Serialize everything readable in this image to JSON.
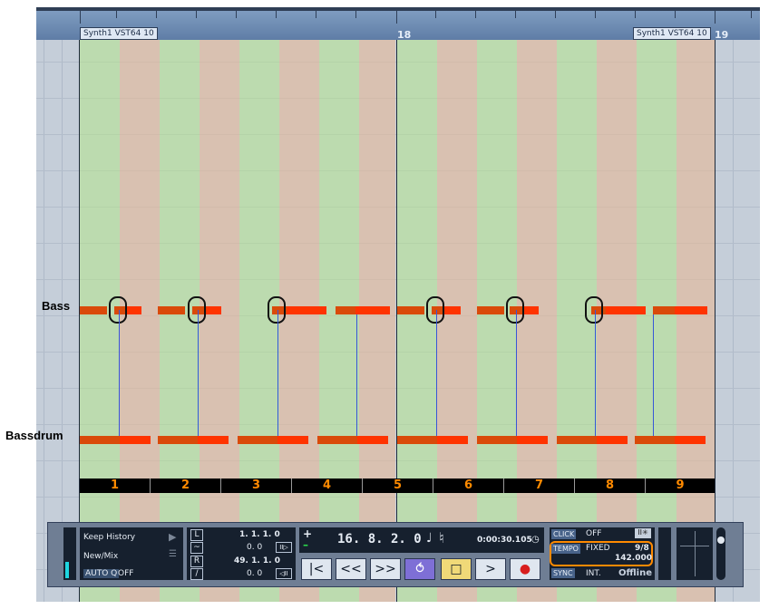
{
  "ruler": {
    "bar_18": "18",
    "bar_19": "19",
    "part_left": "Synth1 VST64 10",
    "part_right": "Synth1 VST64 10"
  },
  "tracks": {
    "bass": "Bass",
    "bassdrum": "Bassdrum"
  },
  "beat_numbers": [
    "1",
    "2",
    "3",
    "4",
    "5",
    "6",
    "7",
    "8",
    "9"
  ],
  "transport": {
    "keep_history": "Keep History",
    "new_mix": "New/Mix",
    "auto_q": "AUTO Q",
    "auto_q_value": "OFF",
    "left_locator": "1. 1. 1.  0",
    "left_locator_sub": "0.  0",
    "right_locator": "49. 1. 1.  0",
    "right_locator_sub": "0.  0",
    "position_bars": "16. 8. 2.  0",
    "position_time": "0:00:30.105",
    "click_label": "CLICK",
    "click_value": "OFF",
    "tempo_label": "TEMPO",
    "tempo_mode": "FIXED",
    "signature": "9/8",
    "tempo_value": "142.000",
    "sync_label": "SYNC",
    "sync_mode": "INT.",
    "sync_status": "Offline",
    "left_marker": "L",
    "right_marker": "R",
    "plus": "+",
    "minus": "–"
  },
  "buttons": {
    "goto_start": "|<",
    "rewind": "<<",
    "forward": ">>",
    "cycle": "⥀",
    "stop": "□",
    "play": ">",
    "record": "●"
  },
  "colors": {
    "green_beat": "#b4e68c",
    "orange_beat": "#e6b996",
    "note": "#d94a0a",
    "note_end": "#ff3300",
    "cursor_line": "#3856d8",
    "beat_number": "#ff8a00",
    "tempo_highlight": "#ff8a00"
  }
}
